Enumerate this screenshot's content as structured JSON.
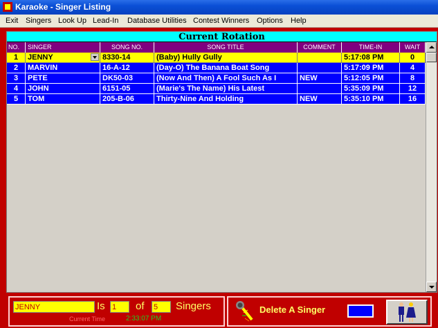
{
  "window": {
    "title": "Karaoke - Singer Listing"
  },
  "menu": [
    "Exit",
    "Singers",
    "Look Up",
    "Lead-In",
    "Database Utilities",
    "Contest Winners",
    "Options",
    "Help"
  ],
  "table": {
    "caption": "Current Rotation",
    "columns": [
      "NO.",
      "SINGER",
      "SONG NO.",
      "SONG TITLE",
      "COMMENT",
      "TIME-IN",
      "WAIT"
    ],
    "rows": [
      {
        "no": "1",
        "singer": "JENNY",
        "song_no": "8330-14",
        "title": "(Baby) Hully Gully",
        "comment": "",
        "time_in": "5:17:08 PM",
        "wait": "0"
      },
      {
        "no": "2",
        "singer": "MARVIN",
        "song_no": "16-A-12",
        "title": "(Day-O) The Banana Boat Song",
        "comment": "",
        "time_in": "5:17:09 PM",
        "wait": "4"
      },
      {
        "no": "3",
        "singer": "PETE",
        "song_no": "DK50-03",
        "title": "(Now And Then) A Fool Such As I",
        "comment": "NEW",
        "time_in": "5:12:05 PM",
        "wait": "8"
      },
      {
        "no": "4",
        "singer": "JOHN",
        "song_no": "6151-05",
        "title": "(Marie's The Name) His Latest",
        "comment": "",
        "time_in": "5:35:09 PM",
        "wait": "12"
      },
      {
        "no": "5",
        "singer": "TOM",
        "song_no": "205-B-06",
        "title": "Thirty-Nine And Holding",
        "comment": "NEW",
        "time_in": "5:35:10 PM",
        "wait": "16"
      }
    ]
  },
  "status": {
    "singer": "JENNY",
    "is_label": "Is",
    "position": "1",
    "of_label": "of",
    "total": "5",
    "singers_label": "Singers",
    "current_time_label": "Current Time",
    "current_time": "2:33:07 PM",
    "delete_label": "Delete A Singer"
  },
  "colors": {
    "accent": "#c00000",
    "header": "#800080",
    "selected": "#ffff00",
    "row": "#0000ff",
    "caption": "#00ffff"
  },
  "icons": {
    "app": "karaoke-app-icon",
    "microphone": "microphone-icon",
    "couple": "singer-couple-icon"
  }
}
